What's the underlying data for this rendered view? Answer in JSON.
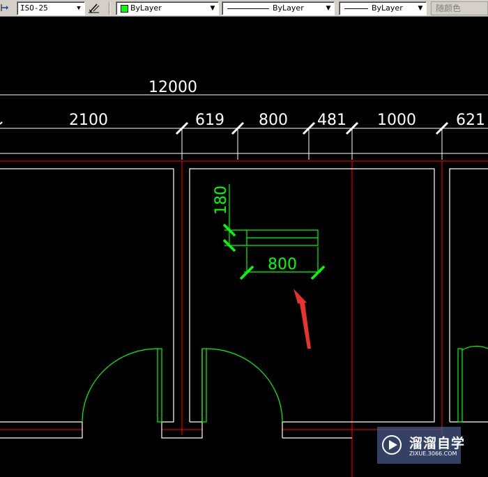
{
  "toolbar": {
    "dimstyle": "ISO-25",
    "layer_color": "ByLayer",
    "linetype": "ByLayer",
    "lineweight": "ByLayer",
    "plotstyle": "随颜色",
    "layer_swatch_color": "#00ff00",
    "dropdown_arrow": "▼"
  },
  "drawing": {
    "overall_dim": "12000",
    "segment_dims": [
      "2100",
      "619",
      "800",
      "481",
      "1000",
      "621"
    ],
    "block_height_dim": "180",
    "block_width_dim": "800",
    "colors": {
      "wall": "#ffffff",
      "axis": "#ff0000",
      "door": "#00ff00",
      "arrow": "#e8322b"
    }
  },
  "watermark": {
    "brand": "溜溜自学",
    "domain": "ZIXUE.3066.COM"
  }
}
